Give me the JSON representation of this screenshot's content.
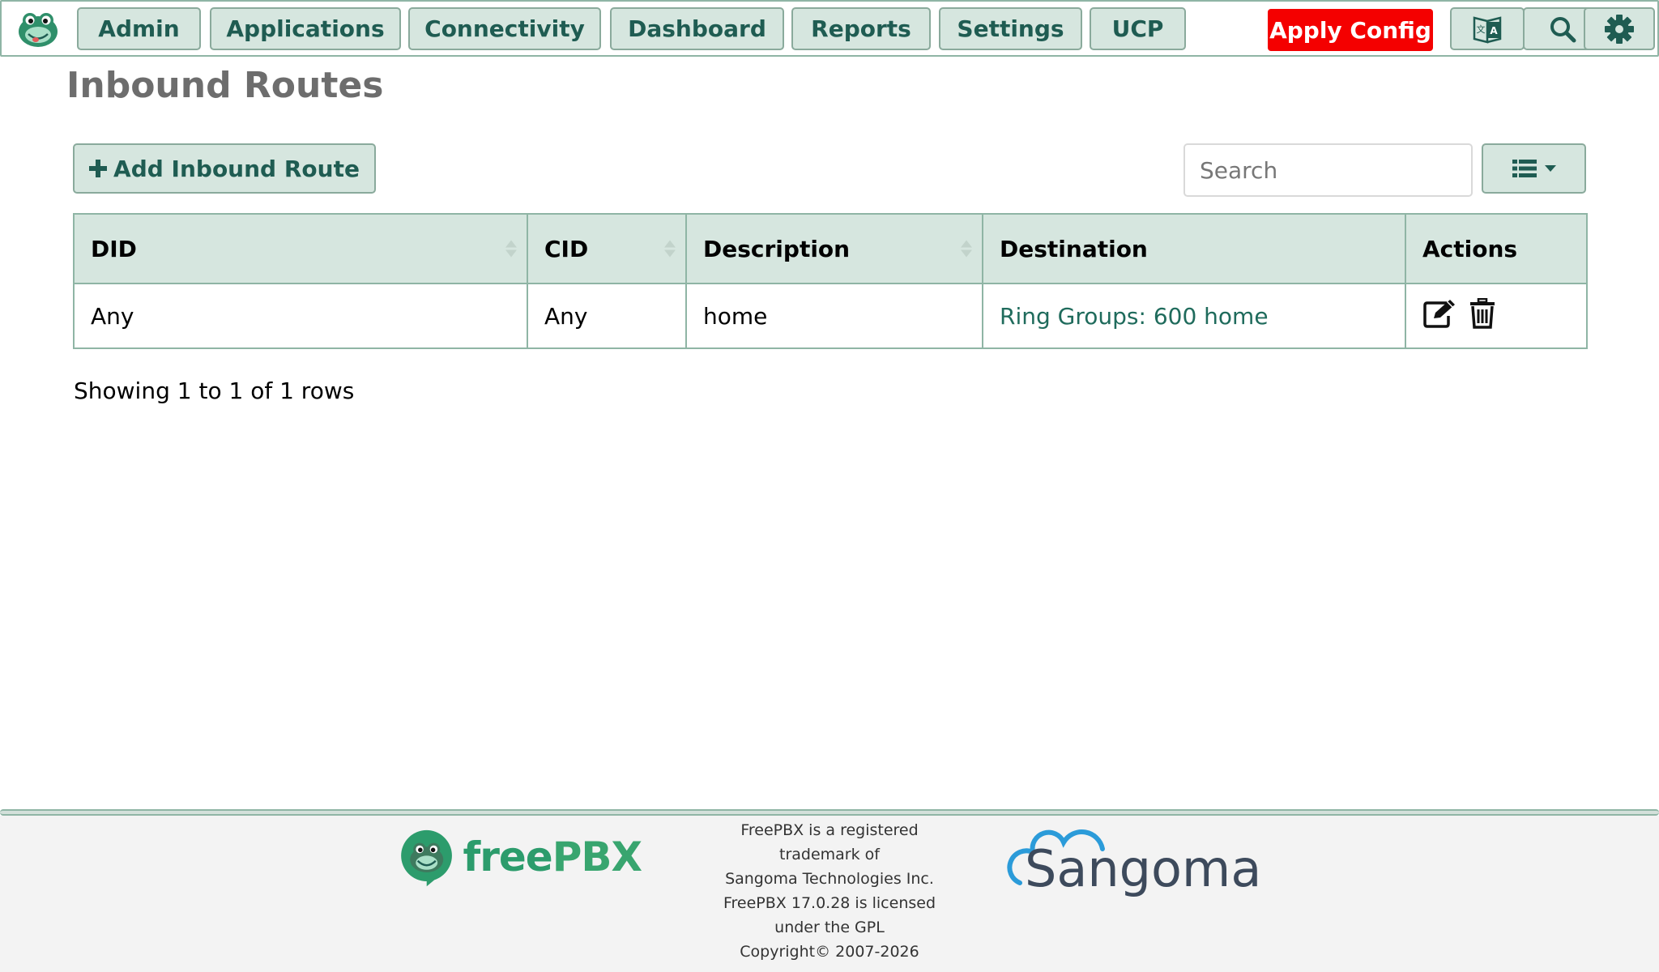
{
  "nav": {
    "items": [
      {
        "label": "Admin"
      },
      {
        "label": "Applications"
      },
      {
        "label": "Connectivity"
      },
      {
        "label": "Dashboard"
      },
      {
        "label": "Reports"
      },
      {
        "label": "Settings"
      },
      {
        "label": "UCP"
      }
    ],
    "apply_label": "Apply Config",
    "icons": [
      "language-icon",
      "search-icon",
      "gear-icon"
    ],
    "accent_color": "#1f5c52",
    "apply_color": "#f40000"
  },
  "page": {
    "title": "Inbound Routes",
    "add_label": "Add Inbound Route"
  },
  "toolbar": {
    "search_placeholder": "Search"
  },
  "table": {
    "columns": [
      "DID",
      "CID",
      "Description",
      "Destination",
      "Actions"
    ],
    "rows": [
      {
        "did": "Any",
        "cid": "Any",
        "description": "home",
        "destination": "Ring Groups: 600 home"
      }
    ],
    "showing": "Showing 1 to 1 of 1 rows"
  },
  "footer": {
    "brand_free": "free",
    "brand_pbx": "PBX",
    "lines": [
      "FreePBX is a registered",
      "trademark of",
      "Sangoma Technologies Inc.",
      "FreePBX 17.0.28 is licensed",
      "under the GPL",
      "Copyright© 2007-2026"
    ],
    "sangoma": "Sangoma"
  }
}
